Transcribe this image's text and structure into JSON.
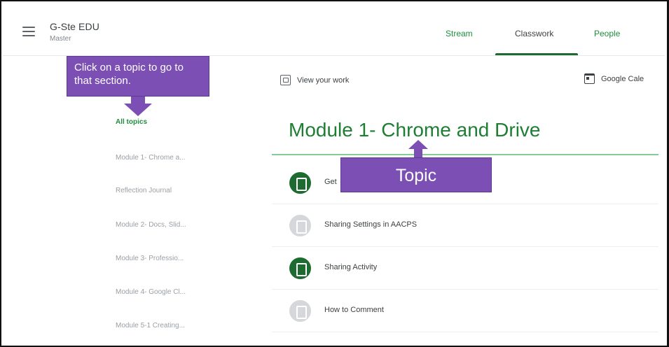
{
  "header": {
    "class_name": "G-Ste EDU",
    "class_section": "Master",
    "tabs": [
      {
        "label": "Stream"
      },
      {
        "label": "Classwork"
      },
      {
        "label": "People"
      }
    ]
  },
  "links": {
    "view_work": "View your work",
    "calendar": "Google Cale"
  },
  "sidebar": {
    "topics": [
      {
        "label": "All topics"
      },
      {
        "label": "Module 1- Chrome a..."
      },
      {
        "label": "Reflection Journal"
      },
      {
        "label": "Module 2- Docs, Slid..."
      },
      {
        "label": "Module 3- Professio..."
      },
      {
        "label": "Module 4- Google Cl..."
      },
      {
        "label": "Module 5-1 Creating..."
      }
    ]
  },
  "main": {
    "topic_title": "Module 1- Chrome and Drive",
    "items": [
      {
        "label": "Get",
        "icon": "assignment-icon",
        "color": "#1e6b32"
      },
      {
        "label": "Sharing Settings in AACPS",
        "icon": "material-icon",
        "color": "#d5d7da"
      },
      {
        "label": "Sharing Activity",
        "icon": "assignment-icon",
        "color": "#1e6b32"
      },
      {
        "label": "How to Comment",
        "icon": "material-icon",
        "color": "#d5d7da"
      }
    ]
  },
  "annotations": {
    "callout_topics": "Click on a topic to go to that section.",
    "callout_topic": "Topic",
    "color": "#7b4fb4"
  }
}
